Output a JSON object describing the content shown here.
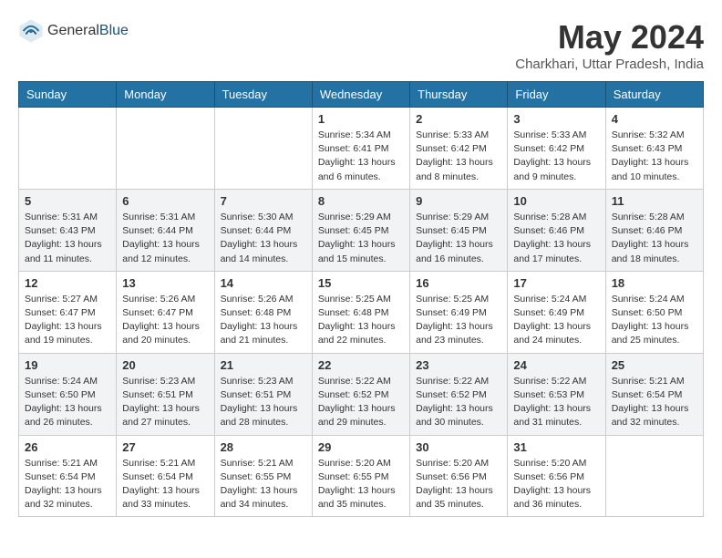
{
  "header": {
    "logo_general": "General",
    "logo_blue": "Blue",
    "month_year": "May 2024",
    "location": "Charkhari, Uttar Pradesh, India"
  },
  "weekdays": [
    "Sunday",
    "Monday",
    "Tuesday",
    "Wednesday",
    "Thursday",
    "Friday",
    "Saturday"
  ],
  "weeks": [
    [
      {
        "day": "",
        "info": ""
      },
      {
        "day": "",
        "info": ""
      },
      {
        "day": "",
        "info": ""
      },
      {
        "day": "1",
        "info": "Sunrise: 5:34 AM\nSunset: 6:41 PM\nDaylight: 13 hours and 6 minutes."
      },
      {
        "day": "2",
        "info": "Sunrise: 5:33 AM\nSunset: 6:42 PM\nDaylight: 13 hours and 8 minutes."
      },
      {
        "day": "3",
        "info": "Sunrise: 5:33 AM\nSunset: 6:42 PM\nDaylight: 13 hours and 9 minutes."
      },
      {
        "day": "4",
        "info": "Sunrise: 5:32 AM\nSunset: 6:43 PM\nDaylight: 13 hours and 10 minutes."
      }
    ],
    [
      {
        "day": "5",
        "info": "Sunrise: 5:31 AM\nSunset: 6:43 PM\nDaylight: 13 hours and 11 minutes."
      },
      {
        "day": "6",
        "info": "Sunrise: 5:31 AM\nSunset: 6:44 PM\nDaylight: 13 hours and 12 minutes."
      },
      {
        "day": "7",
        "info": "Sunrise: 5:30 AM\nSunset: 6:44 PM\nDaylight: 13 hours and 14 minutes."
      },
      {
        "day": "8",
        "info": "Sunrise: 5:29 AM\nSunset: 6:45 PM\nDaylight: 13 hours and 15 minutes."
      },
      {
        "day": "9",
        "info": "Sunrise: 5:29 AM\nSunset: 6:45 PM\nDaylight: 13 hours and 16 minutes."
      },
      {
        "day": "10",
        "info": "Sunrise: 5:28 AM\nSunset: 6:46 PM\nDaylight: 13 hours and 17 minutes."
      },
      {
        "day": "11",
        "info": "Sunrise: 5:28 AM\nSunset: 6:46 PM\nDaylight: 13 hours and 18 minutes."
      }
    ],
    [
      {
        "day": "12",
        "info": "Sunrise: 5:27 AM\nSunset: 6:47 PM\nDaylight: 13 hours and 19 minutes."
      },
      {
        "day": "13",
        "info": "Sunrise: 5:26 AM\nSunset: 6:47 PM\nDaylight: 13 hours and 20 minutes."
      },
      {
        "day": "14",
        "info": "Sunrise: 5:26 AM\nSunset: 6:48 PM\nDaylight: 13 hours and 21 minutes."
      },
      {
        "day": "15",
        "info": "Sunrise: 5:25 AM\nSunset: 6:48 PM\nDaylight: 13 hours and 22 minutes."
      },
      {
        "day": "16",
        "info": "Sunrise: 5:25 AM\nSunset: 6:49 PM\nDaylight: 13 hours and 23 minutes."
      },
      {
        "day": "17",
        "info": "Sunrise: 5:24 AM\nSunset: 6:49 PM\nDaylight: 13 hours and 24 minutes."
      },
      {
        "day": "18",
        "info": "Sunrise: 5:24 AM\nSunset: 6:50 PM\nDaylight: 13 hours and 25 minutes."
      }
    ],
    [
      {
        "day": "19",
        "info": "Sunrise: 5:24 AM\nSunset: 6:50 PM\nDaylight: 13 hours and 26 minutes."
      },
      {
        "day": "20",
        "info": "Sunrise: 5:23 AM\nSunset: 6:51 PM\nDaylight: 13 hours and 27 minutes."
      },
      {
        "day": "21",
        "info": "Sunrise: 5:23 AM\nSunset: 6:51 PM\nDaylight: 13 hours and 28 minutes."
      },
      {
        "day": "22",
        "info": "Sunrise: 5:22 AM\nSunset: 6:52 PM\nDaylight: 13 hours and 29 minutes."
      },
      {
        "day": "23",
        "info": "Sunrise: 5:22 AM\nSunset: 6:52 PM\nDaylight: 13 hours and 30 minutes."
      },
      {
        "day": "24",
        "info": "Sunrise: 5:22 AM\nSunset: 6:53 PM\nDaylight: 13 hours and 31 minutes."
      },
      {
        "day": "25",
        "info": "Sunrise: 5:21 AM\nSunset: 6:54 PM\nDaylight: 13 hours and 32 minutes."
      }
    ],
    [
      {
        "day": "26",
        "info": "Sunrise: 5:21 AM\nSunset: 6:54 PM\nDaylight: 13 hours and 32 minutes."
      },
      {
        "day": "27",
        "info": "Sunrise: 5:21 AM\nSunset: 6:54 PM\nDaylight: 13 hours and 33 minutes."
      },
      {
        "day": "28",
        "info": "Sunrise: 5:21 AM\nSunset: 6:55 PM\nDaylight: 13 hours and 34 minutes."
      },
      {
        "day": "29",
        "info": "Sunrise: 5:20 AM\nSunset: 6:55 PM\nDaylight: 13 hours and 35 minutes."
      },
      {
        "day": "30",
        "info": "Sunrise: 5:20 AM\nSunset: 6:56 PM\nDaylight: 13 hours and 35 minutes."
      },
      {
        "day": "31",
        "info": "Sunrise: 5:20 AM\nSunset: 6:56 PM\nDaylight: 13 hours and 36 minutes."
      },
      {
        "day": "",
        "info": ""
      }
    ]
  ]
}
